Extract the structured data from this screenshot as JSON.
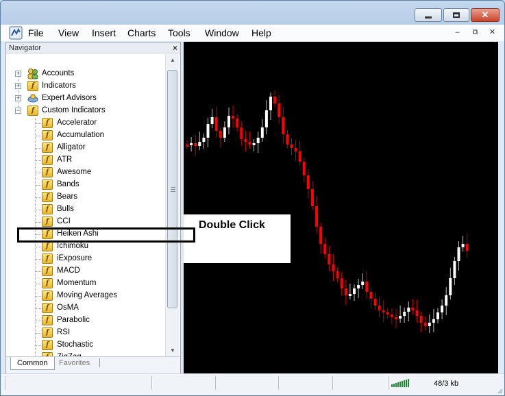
{
  "colors": {
    "bullish": "#ffffff",
    "bearish": "#ff0000",
    "chart_bg": "#000000",
    "accent_title": "#c8442a"
  },
  "window": {
    "controls": {
      "minimize_icon": "minimize-icon",
      "maximize_icon": "maximize-icon",
      "close_icon": "close-icon"
    }
  },
  "menu": {
    "items": [
      "File",
      "View",
      "Insert",
      "Charts",
      "Tools",
      "Window",
      "Help"
    ]
  },
  "mdi_controls": {
    "minimize": "–",
    "restore": "⧉",
    "close": "✕"
  },
  "navigator": {
    "title": "Navigator",
    "close": "×",
    "top_items": [
      {
        "label": "Accounts",
        "icon": "accounts-icon",
        "expander": "+"
      },
      {
        "label": "Indicators",
        "icon": "indicator-icon",
        "expander": "+"
      },
      {
        "label": "Expert Advisors",
        "icon": "expert-advisor-icon",
        "expander": "+"
      },
      {
        "label": "Custom Indicators",
        "icon": "custom-indicator-icon",
        "expander": "−"
      }
    ],
    "custom_indicators": [
      "Accelerator",
      "Accumulation",
      "Alligator",
      "ATR",
      "Awesome",
      "Bands",
      "Bears",
      "Bulls",
      "CCI",
      "Heiken Ashi",
      "Ichimoku",
      "iExposure",
      "MACD",
      "Momentum",
      "Moving Averages",
      "OsMA",
      "Parabolic",
      "RSI",
      "Stochastic",
      "ZigZag"
    ],
    "tabs": [
      "Common",
      "Favorites"
    ],
    "active_tab": "Common"
  },
  "callout": {
    "text": "Double Click"
  },
  "status": {
    "traffic": "48/3 kb"
  }
}
